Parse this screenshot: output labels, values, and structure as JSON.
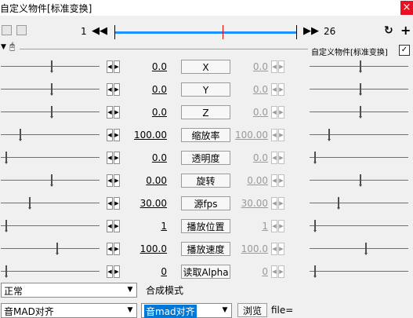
{
  "window": {
    "title": "自定义物件[标准变换]",
    "close_glyph": "×"
  },
  "toolbar": {
    "frame_start": "1",
    "frame_end": "26",
    "prev_glyph": "◀◀",
    "next_glyph": "▶▶",
    "menu_glyph": "▼",
    "mouse_glyph": "🖰",
    "plus_glyph": "+",
    "cycle_glyph": "↻"
  },
  "object_label": "自定义物件[标准变换]",
  "object_checked": "✓",
  "spin_left": "◀",
  "spin_right": "▶",
  "params": [
    {
      "label": "X",
      "left": "0.0",
      "right": "0.0",
      "left_level": 0.52,
      "right_level": 0.52
    },
    {
      "label": "Y",
      "left": "0.0",
      "right": "0.0",
      "left_level": 0.52,
      "right_level": 0.52
    },
    {
      "label": "Z",
      "left": "0.0",
      "right": "0.0",
      "left_level": 0.52,
      "right_level": 0.52
    },
    {
      "label": "缩放率",
      "left": "100.00",
      "right": "100.00",
      "left_level": 0.19,
      "right_level": 0.19
    },
    {
      "label": "透明度",
      "left": "0.0",
      "right": "0.0",
      "left_level": 0.05,
      "right_level": 0.05
    },
    {
      "label": "旋转",
      "left": "0.00",
      "right": "0.00",
      "left_level": 0.52,
      "right_level": 0.52
    },
    {
      "label": "源fps",
      "left": "30.00",
      "right": "30.00",
      "left_level": 0.29,
      "right_level": 0.29
    },
    {
      "label": "播放位置",
      "left": "1",
      "right": "1",
      "left_level": 0.05,
      "right_level": 0.05
    },
    {
      "label": "播放速度",
      "left": "100.0",
      "right": "100.0",
      "left_level": 0.57,
      "right_level": 0.57
    },
    {
      "label": "读取Alpha",
      "left": "0",
      "right": "0",
      "left_level": 0.05,
      "right_level": 0.05
    }
  ],
  "blend": {
    "value": "正常",
    "label": "合成模式"
  },
  "align": {
    "value": "音MAD对齐",
    "script": "音mad对齐",
    "browse": "浏览",
    "file": "file="
  },
  "dropdown_glyph": "▼"
}
